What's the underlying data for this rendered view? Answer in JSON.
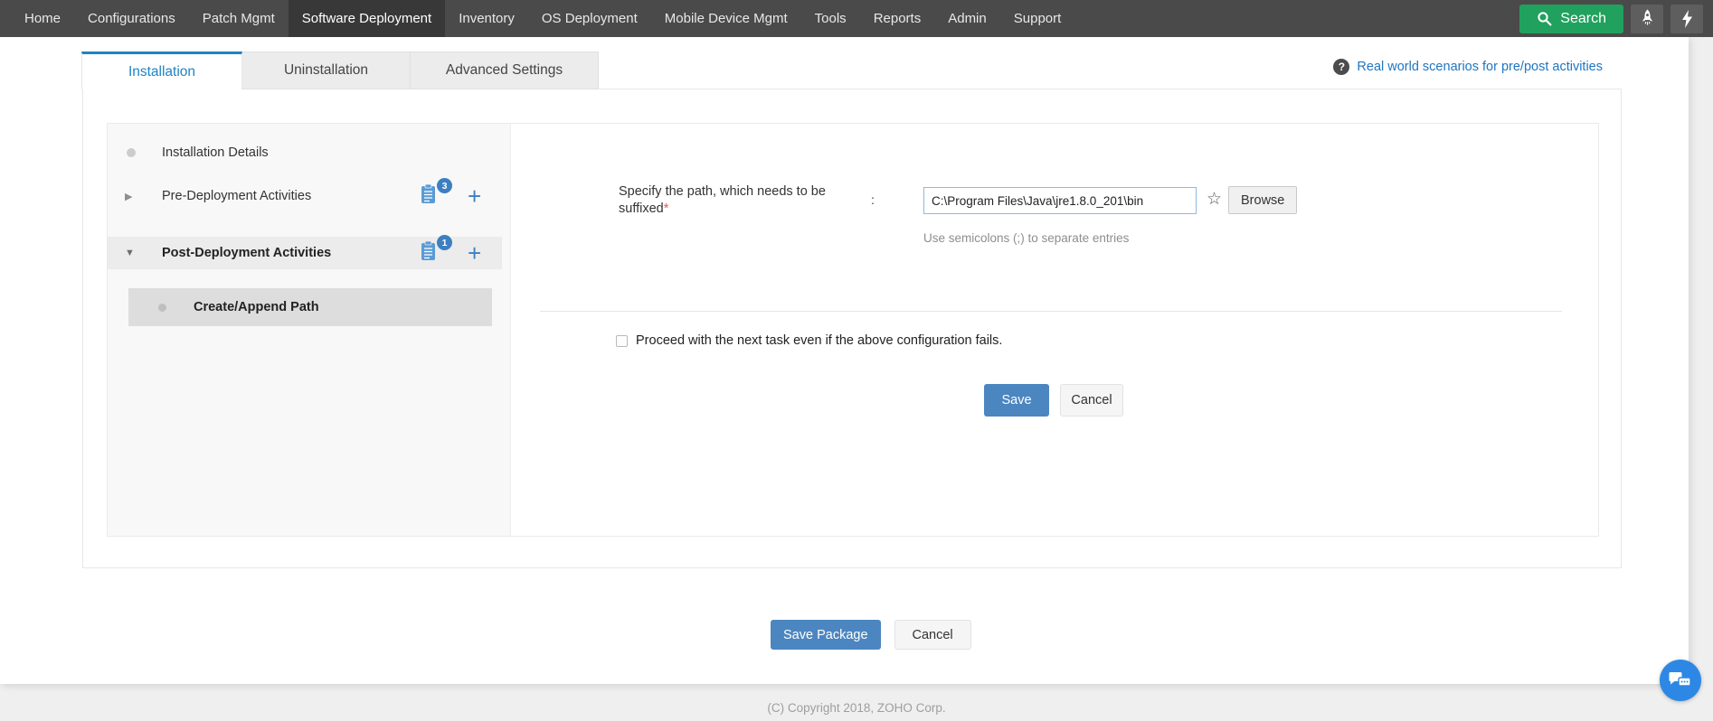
{
  "nav": {
    "items": [
      {
        "label": "Home",
        "active": false
      },
      {
        "label": "Configurations",
        "active": false
      },
      {
        "label": "Patch Mgmt",
        "active": false
      },
      {
        "label": "Software Deployment",
        "active": true
      },
      {
        "label": "Inventory",
        "active": false
      },
      {
        "label": "OS Deployment",
        "active": false
      },
      {
        "label": "Mobile Device Mgmt",
        "active": false
      },
      {
        "label": "Tools",
        "active": false
      },
      {
        "label": "Reports",
        "active": false
      },
      {
        "label": "Admin",
        "active": false
      },
      {
        "label": "Support",
        "active": false
      }
    ]
  },
  "search": {
    "label": "Search"
  },
  "tabs": [
    {
      "label": "Installation",
      "active": true
    },
    {
      "label": "Uninstallation",
      "active": false
    },
    {
      "label": "Advanced Settings",
      "active": false
    }
  ],
  "help_link": {
    "label": "Real world scenarios for pre/post activities"
  },
  "sidebar": {
    "items": [
      {
        "label": "Installation Details"
      },
      {
        "label": "Pre-Deployment Activities",
        "count": "3"
      },
      {
        "label": "Post-Deployment Activities",
        "count": "1"
      },
      {
        "label": "Create/Append Path"
      }
    ]
  },
  "form": {
    "path_label": "Specify the path, which needs to be suffixed",
    "required_marker": "*",
    "separator": ":",
    "path_value": "C:\\Program Files\\Java\\jre1.8.0_201\\bin",
    "browse_label": "Browse",
    "hint": "Use semicolons (;) to separate entries",
    "proceed_label": "Proceed with the next task even if the above configuration fails.",
    "save_label": "Save",
    "cancel_label": "Cancel"
  },
  "package_actions": {
    "save_label": "Save Package",
    "cancel_label": "Cancel"
  },
  "footer": {
    "copyright": "(C) Copyright 2018, ZOHO Corp."
  },
  "colors": {
    "brand_green": "#21a15e",
    "tab_accent_blue": "#1d83c6",
    "button_blue": "#4c86c0",
    "badge_blue": "#3d7fc1",
    "chat_blue": "#2d88e5"
  }
}
